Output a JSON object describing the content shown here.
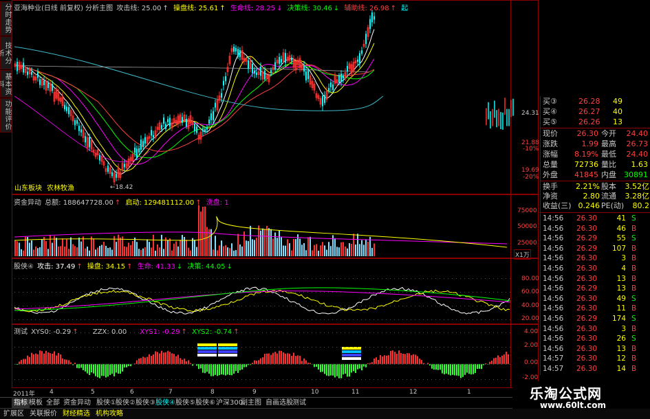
{
  "sidebar": {
    "tabs": [
      "分时走势",
      "技术分析",
      "基本资料",
      "功能评价"
    ]
  },
  "main_chart": {
    "title": "亚海种业(日线 前复权) 分析主图",
    "indicators": [
      {
        "label": "攻击线: 25.00",
        "arrow": "↑",
        "color": "#ffffff"
      },
      {
        "label": "操盘线: 25.61",
        "arrow": "↑",
        "color": "#ffff00"
      },
      {
        "label": "生命线: 28.25",
        "arrow": "↓",
        "color": "#ff00ff"
      },
      {
        "label": "决策线: 30.46",
        "arrow": "↓",
        "color": "#00ff00"
      },
      {
        "label": "辅助线: 26.98",
        "arrow": "↑",
        "color": "#ff4040"
      },
      {
        "label": "起",
        "arrow": "",
        "color": "#00ffff"
      }
    ],
    "price_labels": [
      "24.31",
      "21.88",
      "-10%",
      "19.69",
      "-20%"
    ],
    "low_label": "←18.42",
    "sector_label": "山东板块",
    "concept_label": "农林牧渔"
  },
  "fund_chart": {
    "title": "资金异动",
    "total_label": "总额: 188647728.00",
    "total_arrow": "↑",
    "start_label": "启动: 129481112.00",
    "start_arrow": "↑",
    "wash_label": "洗盘: 1",
    "axis": [
      "75000",
      "50000",
      "25000"
    ],
    "unit": "X1万"
  },
  "stock_chart": {
    "title": "股侠④",
    "attack": "攻击: 37.49",
    "attack_arrow": "↑",
    "operate": "操盘: 34.15",
    "operate_arrow": "↑",
    "life": "生命: 41.33",
    "life_arrow": "↓",
    "decide": "决策: 44.05",
    "decide_arrow": "↓",
    "axis": [
      "80.00",
      "60.00",
      "40.00",
      "20.00"
    ]
  },
  "test_chart": {
    "title": "测试",
    "xys0": "XYS0: -0.29",
    "xys0_arrow": "↑",
    "zzx": "ZZX: 0.00",
    "xys1": "XYS1: -0.29",
    "xys1_arrow": "↑",
    "xys2": "XYS2: -0.74",
    "xys2_arrow": "↑",
    "axis": [
      "4.00",
      "2.00",
      "0.00",
      "-2.00"
    ]
  },
  "date_axis": [
    "2011年",
    "4",
    "5",
    "6",
    "7",
    "8",
    "9",
    "10",
    "11",
    "12",
    "1"
  ],
  "quote": {
    "bids": [
      {
        "label": "买③",
        "price": "26.28",
        "vol": "49"
      },
      {
        "label": "买④",
        "price": "26.27",
        "vol": "40"
      },
      {
        "label": "买⑤",
        "price": "26.26",
        "vol": "13"
      }
    ],
    "stats": [
      {
        "l1": "现价",
        "v1": "26.30",
        "l2": "今开",
        "v2": "24.40"
      },
      {
        "l1": "涨跌",
        "v1": "1.99",
        "l2": "最高",
        "v2": "26.73"
      },
      {
        "l1": "涨幅",
        "v1": "8.19%",
        "l2": "最低",
        "v2": "24.40"
      },
      {
        "l1": "总量",
        "v1": "72736",
        "l2": "量比",
        "v2": "1.63"
      },
      {
        "l1": "外盘",
        "v1": "41845",
        "l2": "内盘",
        "v2": "30891"
      }
    ],
    "fund": [
      {
        "l1": "换手",
        "v1": "2.21%",
        "l2": "股本",
        "v2": "3.52亿"
      },
      {
        "l1": "净资",
        "v1": "2.80",
        "l2": "流通",
        "v2": "3.28亿"
      },
      {
        "l1": "收益(三)",
        "v1": "0.246",
        "l2": "PE(动)",
        "v2": "80.2"
      }
    ]
  },
  "ticks": [
    {
      "time": "14:56",
      "price": "26.30",
      "vol": "41",
      "side": "S"
    },
    {
      "time": "14:56",
      "price": "26.30",
      "vol": "46",
      "side": "B"
    },
    {
      "time": "14:56",
      "price": "26.29",
      "vol": "55",
      "side": "S"
    },
    {
      "time": "14:56",
      "price": "26.29",
      "vol": "107",
      "side": "B"
    },
    {
      "time": "14:56",
      "price": "26.30",
      "vol": "3",
      "side": "B"
    },
    {
      "time": "14:56",
      "price": "26.30",
      "vol": "4",
      "side": "B"
    },
    {
      "time": "14:56",
      "price": "26.30",
      "vol": "13",
      "side": "B"
    },
    {
      "time": "14:56",
      "price": "26.29",
      "vol": "13",
      "side": "B"
    },
    {
      "time": "14:56",
      "price": "26.30",
      "vol": "49",
      "side": "S"
    },
    {
      "time": "14:56",
      "price": "26.30",
      "vol": "11",
      "side": "B"
    },
    {
      "time": "14:56",
      "price": "26.29",
      "vol": "174",
      "side": "S"
    },
    {
      "time": "14:56",
      "price": "26.30",
      "vol": "3",
      "side": "B"
    },
    {
      "time": "14:56",
      "price": "26.30",
      "vol": "26",
      "side": "S"
    },
    {
      "time": "14:56",
      "price": "26.30",
      "vol": "13",
      "side": "B"
    },
    {
      "time": "14:57",
      "price": "26.30",
      "vol": "12",
      "side": "B"
    },
    {
      "time": "14:57",
      "price": "26.30",
      "vol": "14",
      "side": "B"
    }
  ],
  "tabs": [
    "指标",
    "模板",
    "全部",
    "资金异动",
    "股侠①",
    "股侠②",
    "股侠③",
    "股侠④",
    "股侠⑤",
    "股侠⑥",
    "沪深300",
    "副主图",
    "自画选股",
    "测试"
  ],
  "bottom_tabs": [
    "扩展区",
    "关联报价",
    "财经精选",
    "机构攻略"
  ],
  "watermark": {
    "title": "乐淘公式网",
    "url": "www.60lt.com"
  }
}
